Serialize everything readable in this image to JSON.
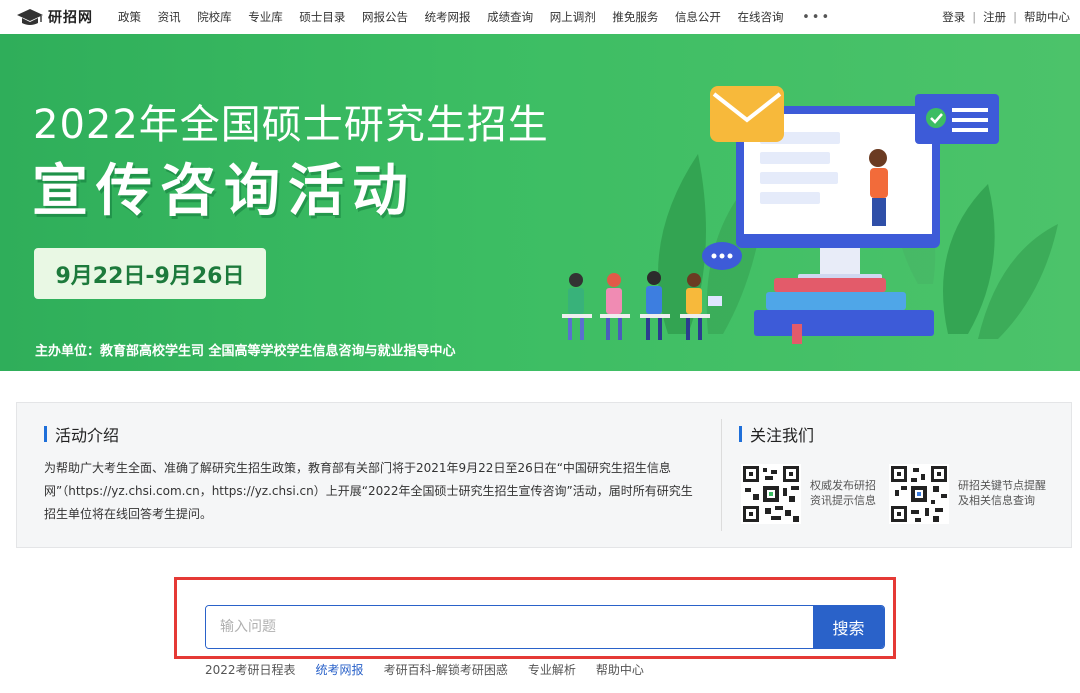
{
  "header": {
    "logo_text": "研招网",
    "nav_items": [
      "政策",
      "资讯",
      "院校库",
      "专业库",
      "硕士目录",
      "网报公告",
      "统考网报",
      "成绩查询",
      "网上调剂",
      "推免服务",
      "信息公开",
      "在线咨询"
    ],
    "more_label": "•••",
    "login": "登录",
    "register": "注册",
    "help": "帮助中心",
    "separator": "|"
  },
  "banner": {
    "title_line1": "2022年全国硕士研究生招生",
    "title_line2": "宣传咨询活动",
    "date_range": "9月22日-9月26日",
    "organizer": "主办单位：教育部高校学生司  全国高等学校学生信息咨询与就业指导中心",
    "colors": {
      "green": "#3cbd63",
      "pill_bg": "#e9f8e4"
    }
  },
  "intro": {
    "title": "活动介绍",
    "text": "为帮助广大考生全面、准确了解研究生招生政策，教育部有关部门将于2021年9月22日至26日在“中国研究生招生信息网”（https://yz.chsi.com.cn，https://yz.chsi.cn）上开展“2022年全国硕士研究生招生宣传咨询”活动，届时所有研究生招生单位将在线回答考生提问。"
  },
  "follow": {
    "title": "关注我们",
    "qr1_caption_line1": "权威发布研招",
    "qr1_caption_line2": "资讯提示信息",
    "qr2_caption_line1": "研招关键节点提醒",
    "qr2_caption_line2": "及相关信息查询"
  },
  "search": {
    "placeholder": "输入问题",
    "value": "",
    "button_label": "搜索",
    "accent": "#2a62c9",
    "highlight": "#e53935"
  },
  "quick_links": [
    "2022考研日程表",
    "统考网报",
    "考研百科-解锁考研困惑",
    "专业解析",
    "帮助中心"
  ],
  "quick_links_active_index": 1
}
